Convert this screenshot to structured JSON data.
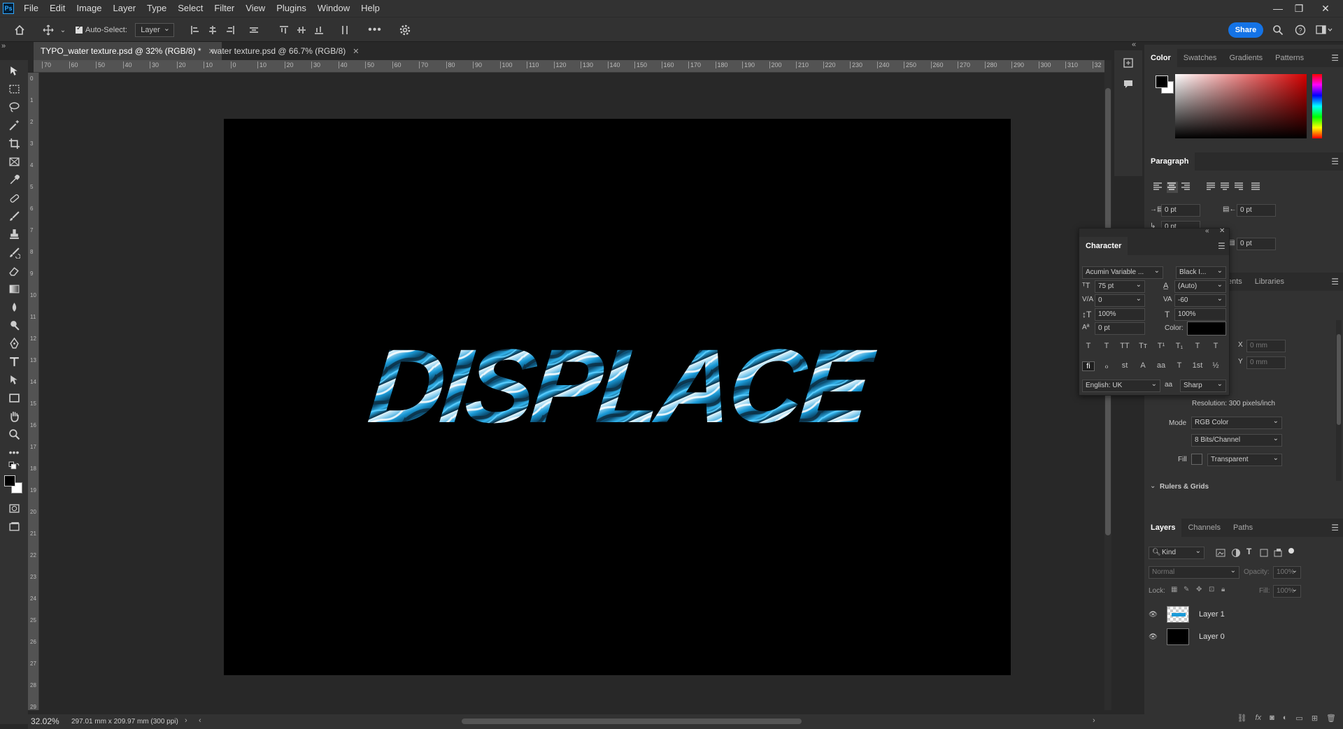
{
  "menu": {
    "items": [
      "File",
      "Edit",
      "Image",
      "Layer",
      "Type",
      "Select",
      "Filter",
      "View",
      "Plugins",
      "Window",
      "Help"
    ],
    "logo": "Ps"
  },
  "options": {
    "auto_select_label": "Auto-Select:",
    "auto_select_checked": true,
    "target_value": "Layer",
    "share_label": "Share"
  },
  "tabs": [
    {
      "label": "TYPO_water texture.psd @ 32% (RGB/8) *",
      "active": true
    },
    {
      "label": "water texture.psd @ 66.7% (RGB/8)",
      "active": false
    }
  ],
  "ruler": {
    "top_labels": [
      "70",
      "60",
      "50",
      "40",
      "30",
      "20",
      "10",
      "0",
      "10",
      "20",
      "30",
      "40",
      "50",
      "60",
      "70",
      "80",
      "90",
      "100",
      "110",
      "120",
      "130",
      "140",
      "150",
      "160",
      "170",
      "180",
      "190",
      "200",
      "210",
      "220",
      "230",
      "240",
      "250",
      "260",
      "270",
      "280",
      "290",
      "300",
      "310",
      "32"
    ],
    "left_labels": [
      "0",
      "1",
      "2",
      "3",
      "4",
      "5",
      "6",
      "7",
      "8",
      "9",
      "10",
      "11",
      "12",
      "13",
      "14",
      "15",
      "16",
      "17",
      "18",
      "19",
      "20",
      "21",
      "22",
      "23",
      "24",
      "25",
      "26",
      "27",
      "28",
      "29"
    ]
  },
  "canvas": {
    "text": "DISPLACE",
    "text_color": "#1b9bd8",
    "background": "#000000"
  },
  "status": {
    "zoom": "32.02%",
    "doc_info": "297.01 mm x 209.97 mm (300 ppi)"
  },
  "color_panel": {
    "tabs": [
      "Color",
      "Swatches",
      "Gradients",
      "Patterns"
    ],
    "foreground": "#000000",
    "background": "#ffffff"
  },
  "paragraph_panel": {
    "title": "Paragraph",
    "indent_left": "0 pt",
    "indent_right": "0 pt",
    "indent_first": "0 pt",
    "space_after": "0 pt"
  },
  "character_panel": {
    "title": "Character",
    "font_family": "Acumin Variable ...",
    "font_style": "Black I...",
    "font_size": "75 pt",
    "leading": "(Auto)",
    "kerning": "0",
    "tracking": "-60",
    "vertical_scale": "100%",
    "horizontal_scale": "100%",
    "baseline_shift": "0 pt",
    "color_label": "Color:",
    "language": "English: UK",
    "antialias_label": "aa",
    "antialias": "Sharp",
    "glyphs_row1": [
      "T",
      "T",
      "TT",
      "Tт",
      "T¹",
      "T₁",
      "T",
      "T"
    ],
    "glyphs_row2": [
      "fi",
      "ℴ",
      "st",
      "A",
      "aa",
      "T",
      "1st",
      "½"
    ]
  },
  "properties_panel": {
    "tabs_visible": [
      "ents",
      "Libraries"
    ],
    "x_label": "X",
    "y_label": "Y",
    "x_value": "0 mm",
    "y_value": "0 mm",
    "resolution": "Resolution: 300 pixels/inch",
    "mode_label": "Mode",
    "mode_value": "RGB Color",
    "bits_value": "8 Bits/Channel",
    "fill_label": "Fill",
    "fill_value": "Transparent",
    "rulers_grids": "Rulers & Grids"
  },
  "layers_panel": {
    "tabs": [
      "Layers",
      "Channels",
      "Paths"
    ],
    "filter_kind": "Kind",
    "blend_mode": "Normal",
    "opacity_label": "Opacity:",
    "opacity_value": "100%",
    "lock_label": "Lock:",
    "fill_label": "Fill:",
    "fill_value": "100%",
    "layers": [
      {
        "name": "Layer 1",
        "visible": true
      },
      {
        "name": "Layer 0",
        "visible": true
      }
    ]
  }
}
